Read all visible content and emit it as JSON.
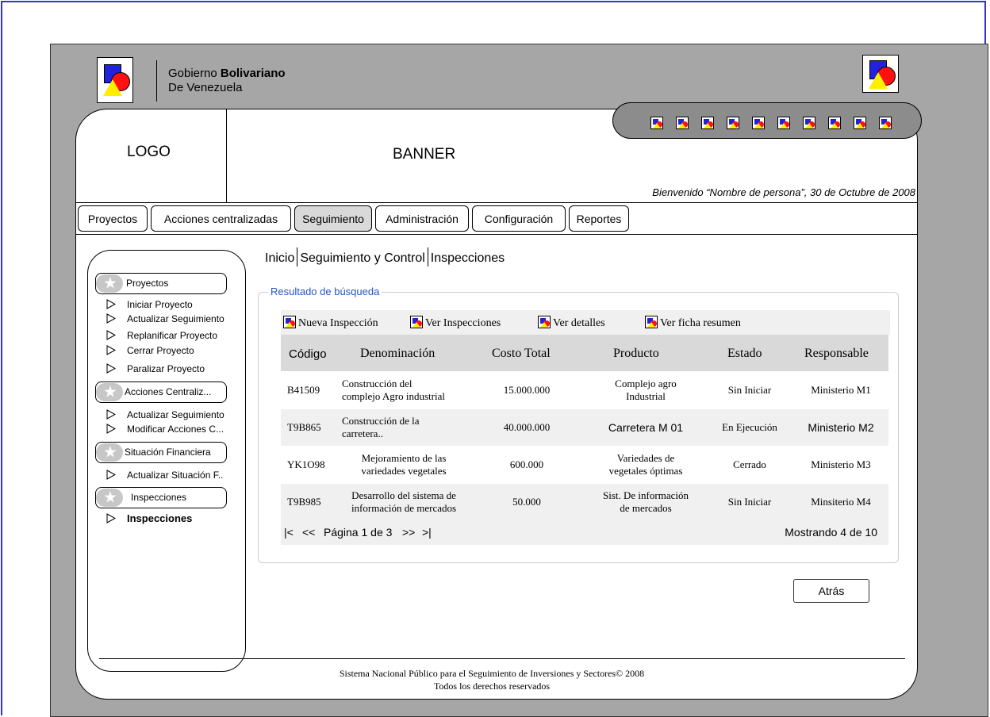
{
  "header": {
    "gobierno_prefix": "Gobierno",
    "gobierno_bold": "Bolivariano",
    "gobierno_line2": "De Venezuela",
    "logo_placeholder": "LOGO",
    "banner_placeholder": "BANNER",
    "welcome": "Bienvenido “Nombre de persona”, 30 de Octubre de 2008"
  },
  "toolbar_icons": [
    "app-icon",
    "app-icon",
    "app-icon",
    "app-icon",
    "app-icon",
    "app-icon",
    "app-icon",
    "app-icon",
    "app-icon",
    "app-icon"
  ],
  "tabs": [
    {
      "label": "Proyectos"
    },
    {
      "label": "Acciones centralizadas"
    },
    {
      "label": "Seguimiento",
      "active": true
    },
    {
      "label": "Administración"
    },
    {
      "label": "Configuración"
    },
    {
      "label": "Reportes"
    }
  ],
  "sidebar": {
    "sections": [
      {
        "title": "Proyectos",
        "items": [
          "Iniciar Proyecto",
          "Actualizar Seguimiento",
          "Replanificar Proyecto",
          "Cerrar Proyecto",
          "Paralizar Proyecto"
        ]
      },
      {
        "title": "Acciones Centraliz...",
        "items": [
          "Actualizar Seguimiento",
          "Modificar Acciones C..."
        ]
      },
      {
        "title": "Situación Financiera",
        "items": [
          "Actualizar Situación F.."
        ]
      },
      {
        "title": "Inspecciones",
        "items": [
          "Inspecciones"
        ]
      }
    ]
  },
  "breadcrumb": [
    "Inicio",
    "Seguimiento y Control",
    "Inspecciones"
  ],
  "results": {
    "legend": "Resultado de búsqueda",
    "actions": [
      "Nueva Inspección",
      "Ver Inspecciones",
      "Ver detalles",
      "Ver ficha resumen"
    ],
    "columns": [
      "Código",
      "Denominación",
      "Costo Total",
      "Producto",
      "Estado",
      "Responsable"
    ],
    "rows": [
      {
        "codigo": "B41509",
        "denominacion": [
          "Construcción del",
          "complejo Agro industrial"
        ],
        "costo": "15.000.000",
        "producto": [
          "Complejo agro",
          "Industrial"
        ],
        "estado": "Sin Iniciar",
        "responsable": "Ministerio M1"
      },
      {
        "codigo": "T9B865",
        "denominacion": [
          "Construcción de la",
          "carretera.."
        ],
        "costo": "40.000.000",
        "producto": [
          "Carretera M 01"
        ],
        "estado": "En Ejecución",
        "responsable": "Ministerio M2"
      },
      {
        "codigo": "YK1O98",
        "denominacion": [
          "Mejoramiento de las",
          "variedades vegetales"
        ],
        "costo": "600.000",
        "producto": [
          "Variedades de",
          "vegetales óptimas"
        ],
        "estado": "Cerrado",
        "responsable": "Ministerio M3"
      },
      {
        "codigo": "T9B985",
        "denominacion": [
          "Desarrollo del sistema de",
          "información de mercados"
        ],
        "costo": "50.000",
        "producto": [
          "Sist. De información",
          "de mercados"
        ],
        "estado": "Sin Iniciar",
        "responsable": "Minsiterio M4"
      }
    ],
    "pager": {
      "first": "|<",
      "prev": "<<",
      "page_text": "Página 1 de 3",
      "next": ">>",
      "last": ">|",
      "showing": "Mostrando 4 de 10"
    }
  },
  "back_button": "Atrás",
  "footer": {
    "line1": "Sistema Nacional Público para el Seguimiento de Inversiones y Sectores© 2008",
    "line2": "Todos los derechos reservados"
  }
}
